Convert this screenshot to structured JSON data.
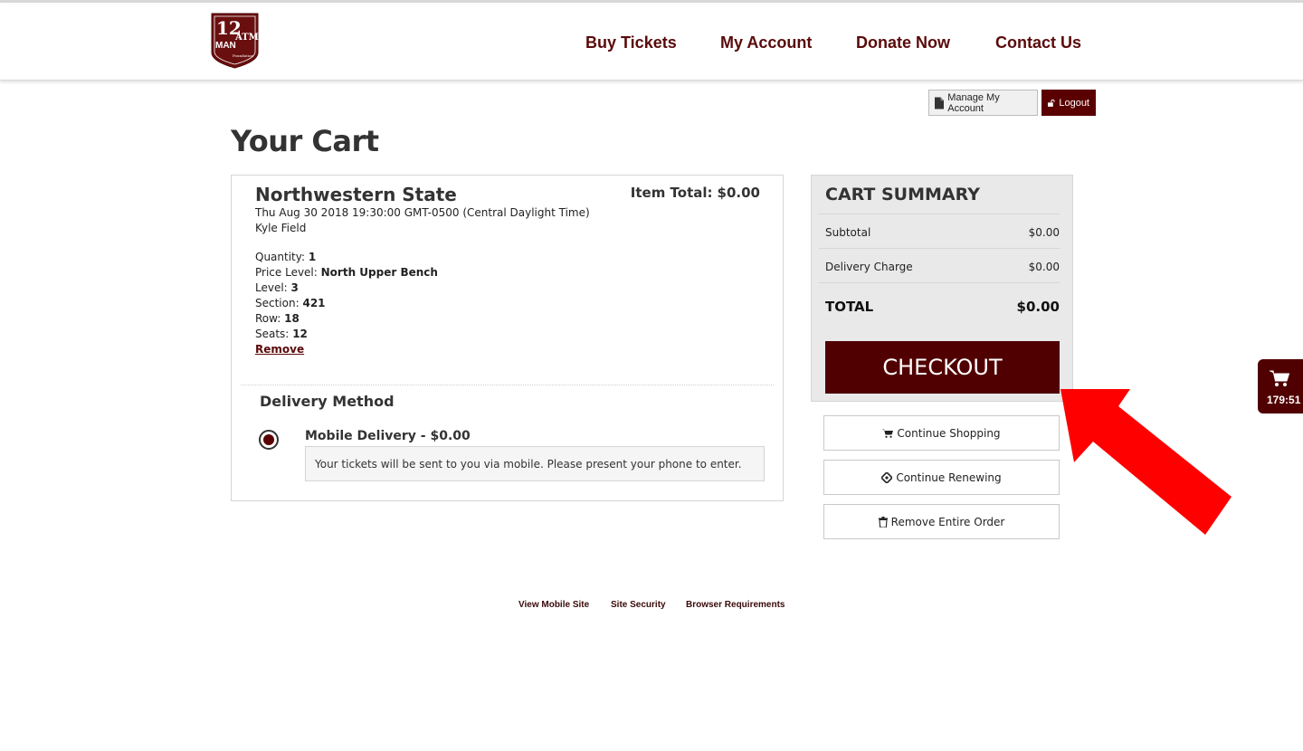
{
  "header": {
    "logo": {
      "text_top": "12",
      "text_bottom": "MAN",
      "text_right": "ATM",
      "text_small": "Foundation"
    },
    "nav": [
      "Buy Tickets",
      "My Account",
      "Donate Now",
      "Contact Us"
    ]
  },
  "account_bar": {
    "manage_label": "Manage My Account",
    "logout_label": "Logout"
  },
  "page_title": "Your Cart",
  "cart_item": {
    "event_name": "Northwestern State",
    "item_total_label": "Item Total:",
    "item_total_value": "$0.00",
    "datetime": "Thu Aug 30 2018 19:30:00 GMT-0500 (Central Daylight Time)",
    "venue": "Kyle Field",
    "details": [
      {
        "label": "Quantity:",
        "value": "1"
      },
      {
        "label": "Price Level:",
        "value": "North Upper Bench"
      },
      {
        "label": "Level:",
        "value": "3"
      },
      {
        "label": "Section:",
        "value": "421"
      },
      {
        "label": "Row:",
        "value": "18"
      },
      {
        "label": "Seats:",
        "value": "12"
      }
    ],
    "remove_label": "Remove",
    "delivery_heading": "Delivery Method",
    "delivery_option": "Mobile Delivery - $0.00",
    "delivery_note": "Your tickets will be sent to you via mobile. Please present your phone to enter."
  },
  "summary": {
    "title": "CART SUMMARY",
    "rows": [
      {
        "label": "Subtotal",
        "value": "$0.00"
      },
      {
        "label": "Delivery Charge",
        "value": "$0.00"
      }
    ],
    "total_label": "TOTAL",
    "total_value": "$0.00",
    "checkout_label": "CHECKOUT"
  },
  "actions": {
    "continue_shopping": "Continue Shopping",
    "continue_renewing": "Continue Renewing",
    "remove_order": "Remove Entire Order"
  },
  "cart_timer": "179:51",
  "footer": [
    "View Mobile Site",
    "Site Security",
    "Browser Requirements"
  ],
  "colors": {
    "maroon": "#500000",
    "arrow": "#ff0000"
  },
  "icons": [
    "document-icon",
    "unlock-icon",
    "shopping-cart-icon",
    "ticket-icon",
    "trash-icon",
    "pointer-arrow-icon"
  ]
}
